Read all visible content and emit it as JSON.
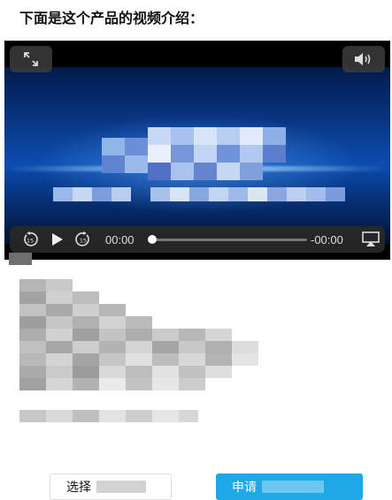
{
  "intro_text": "下面是这个产品的视频介绍：",
  "video": {
    "current_time": "00:00",
    "remaining_time": "-00:00",
    "progress": 0,
    "icons": [
      "fullscreen-icon",
      "volume-icon",
      "rewind-15-icon",
      "play-icon",
      "forward-15-icon",
      "airplay-icon"
    ]
  },
  "buttons": {
    "select_label": "选择",
    "apply_label": "申请"
  },
  "colors": {
    "apply_button": "#1fa8e8",
    "player_background": "#000000"
  }
}
